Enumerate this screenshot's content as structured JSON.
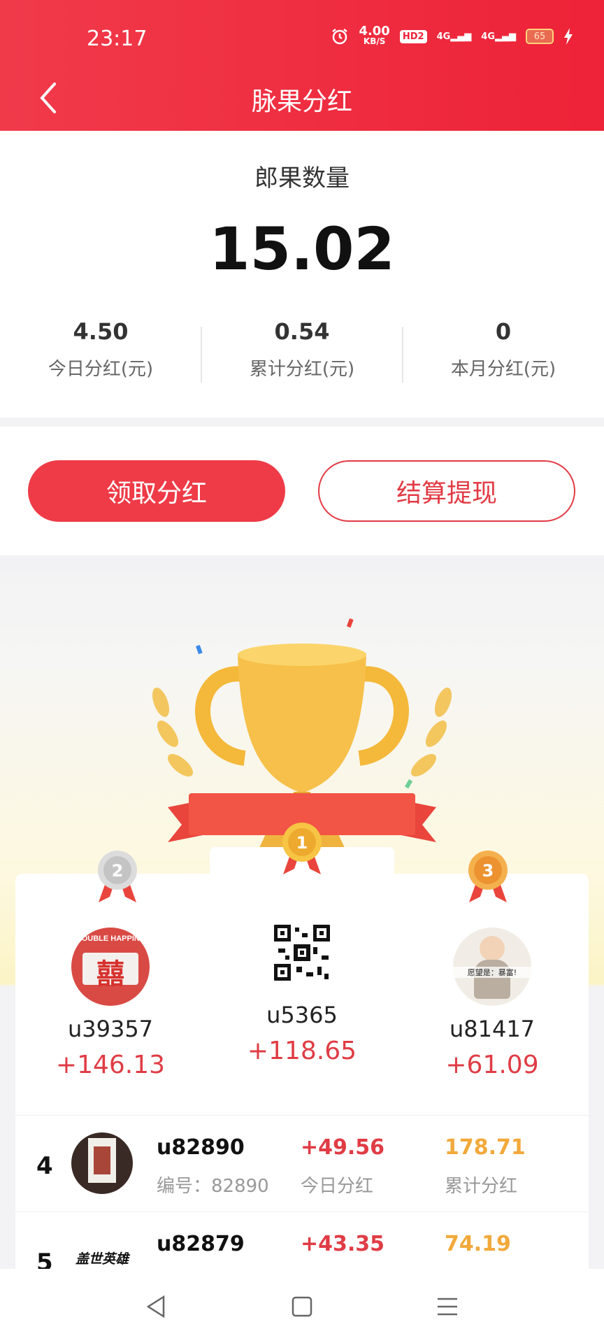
{
  "status": {
    "time": "23:17",
    "net_speed": "4.00",
    "net_unit": "KB/S",
    "hd": "HD2",
    "sig1": "4G",
    "sig2": "4G",
    "battery": "65"
  },
  "header": {
    "title": "脉果分红"
  },
  "summary": {
    "label": "郎果数量",
    "value": "15.02",
    "stats": [
      {
        "value": "4.50",
        "label": "今日分红(元)"
      },
      {
        "value": "0.54",
        "label": "累计分红(元)"
      },
      {
        "value": "0",
        "label": "本月分红(元)"
      }
    ]
  },
  "actions": {
    "claim": "领取分红",
    "withdraw": "结算提现"
  },
  "podium": {
    "first": {
      "rank": "1",
      "name": "u5365",
      "amount": "+118.65"
    },
    "second": {
      "rank": "2",
      "name": "u39357",
      "amount": "+146.13",
      "avatar_text": "囍",
      "avatar_caption": "DOUBLE HAPPINE"
    },
    "third": {
      "rank": "3",
      "name": "u81417",
      "amount": "+61.09",
      "avatar_text": "愿望是：暴富!"
    }
  },
  "list": [
    {
      "rank": "4",
      "name": "u82890",
      "id": "编号：82890",
      "today": "+49.56",
      "today_label": "今日分红",
      "total": "178.71",
      "total_label": "累计分红"
    },
    {
      "rank": "5",
      "name": "u82879",
      "id": "",
      "today": "+43.35",
      "today_label": "",
      "total": "74.19",
      "total_label": "",
      "avatar_text": "盖世英雄"
    }
  ],
  "colors": {
    "brand_red": "#ee2238",
    "amount_red": "#e03c45",
    "gold": "#f2a93b"
  }
}
